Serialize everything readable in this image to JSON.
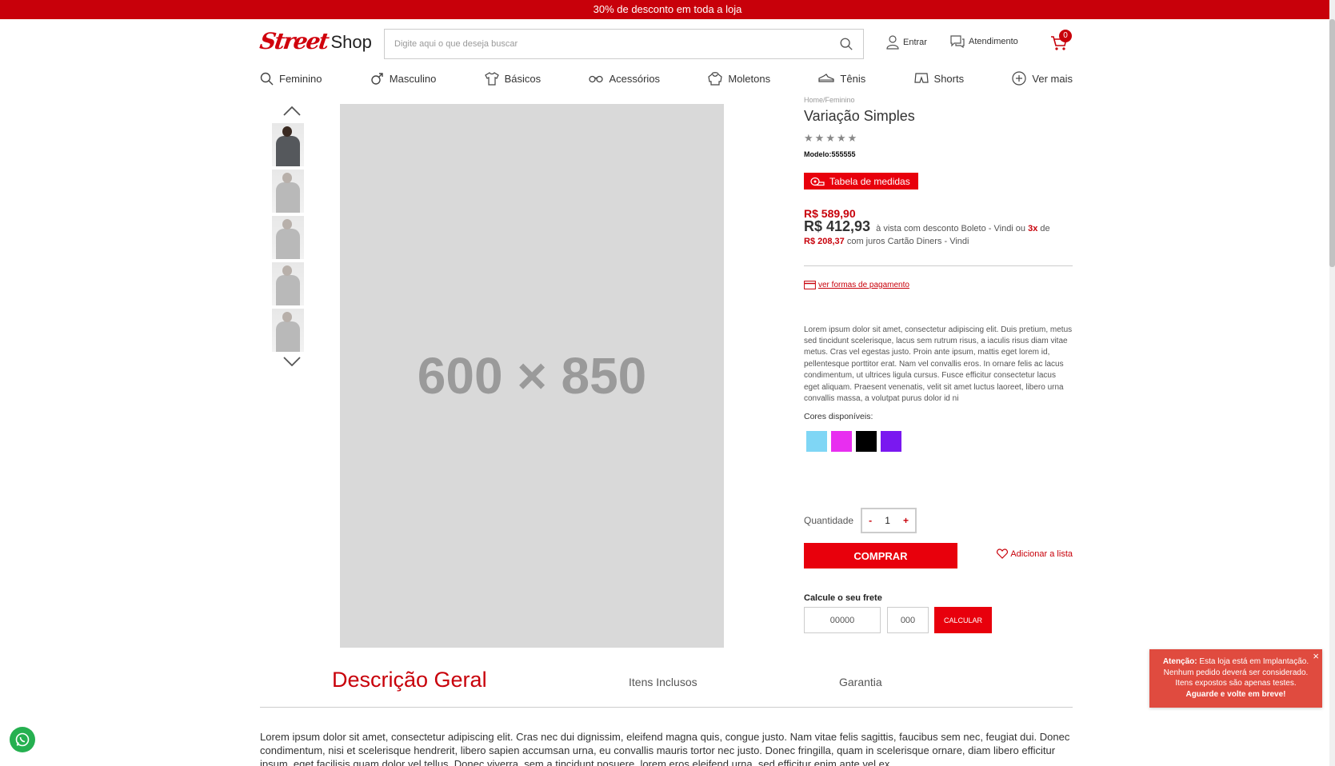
{
  "topbar": {
    "text": "30% de desconto em toda a loja"
  },
  "header": {
    "logo_mark": "Street",
    "logo_text": "Shop",
    "search_placeholder": "Digite aqui o que deseja buscar",
    "login_label": "Entrar",
    "support_label": "Atendimento",
    "cart_count": "0"
  },
  "nav": {
    "items": [
      {
        "label": "Feminino",
        "icon": "search-icon"
      },
      {
        "label": "Masculino",
        "icon": "male-symbol-icon"
      },
      {
        "label": "Básicos",
        "icon": "tshirt-icon"
      },
      {
        "label": "Acessórios",
        "icon": "glasses-icon"
      },
      {
        "label": "Moletons",
        "icon": "hoodie-icon"
      },
      {
        "label": "Tênis",
        "icon": "sneaker-icon"
      },
      {
        "label": "Shorts",
        "icon": "shorts-icon"
      },
      {
        "label": "Ver mais",
        "icon": "plus-circle-icon"
      }
    ]
  },
  "gallery": {
    "placeholder": "600 × 850",
    "thumb_count": 5,
    "active_thumb": 0
  },
  "product": {
    "breadcrumb_home": "Home",
    "breadcrumb_sep": "/",
    "breadcrumb_cat": "Feminino",
    "title": "Variação Simples",
    "rating": 0,
    "model_label": "Modelo:",
    "model_value": "555555",
    "size_table_label": "Tabela de medidas",
    "price_old": "R$ 589,90",
    "price_cash": "R$ 412,93",
    "price_cash_text": "à vista com desconto Boleto - Vindi ou",
    "installments": "3x",
    "installments_de": "de",
    "installment_value": "R$ 208,37",
    "installment_text": "com juros Cartão Diners - Vindi",
    "payment_link": "ver formas de pagamento",
    "description": "Lorem ipsum dolor sit amet, consectetur adipiscing elit. Duis pretium, metus sed tincidunt scelerisque, lacus sem rutrum risus, a iaculis risus diam vitae metus. Cras vel egestas justo. Proin ante ipsum, mattis eget lorem id, pellentesque porttitor erat. Nam vel convallis eros. In ornare felis ac lacus condimentum, ut ultrices ligula cursus. Fusce efficitur consectetur lacus eget aliquam. Praesent venenatis, velit sit amet luctus laoreet, libero urna convallis massa, a volutpat purus dolor id ni",
    "colors_label": "Cores disponíveis:",
    "colors": [
      "#7fd6f5",
      "#e82ef0",
      "#000000",
      "#7a18f0"
    ],
    "qty_label": "Quantidade",
    "qty_minus": "-",
    "qty_value": "1",
    "qty_plus": "+",
    "buy_label": "COMPRAR",
    "wishlist_label": "Adicionar a lista",
    "freight_label": "Calcule o seu frete",
    "cep1_placeholder": "00000",
    "cep2_placeholder": "000",
    "calc_label": "CALCULAR"
  },
  "tabs": {
    "active": "Descrição Geral",
    "second": "Itens Inclusos",
    "third": "Garantia"
  },
  "body_text": "Lorem ipsum dolor sit amet, consectetur adipiscing elit. Cras nec dui dignissim, eleifend magna quis, congue justo. Nam vitae felis sagittis, faucibus sem nec, feugiat dui. Donec condimentum, nisi et scelerisque hendrerit, libero sapien accumsan urna, eu convallis mauris tortor nec justo. Donec fringilla, quam in scelerisque ornare, diam libero efficitur ipsum, eget facilisis quam dolor vel tellus. Donec viverra, sem a tincidunt posuere, lorem eros eleifend urna, sed efficitur enim ante vel ex.",
  "toast": {
    "bold_label": "Atenção:",
    "text": "Esta loja está em Implantação. Nenhum pedido deverá ser considerado. Itens expostos são apenas testes.",
    "closing": "Aguarde e volte em breve!",
    "close": "×"
  },
  "colors": {
    "brand_red": "#c8000a",
    "button_red": "#e8000c",
    "toast_red": "#e04b3f",
    "whatsapp_green": "#25b050"
  }
}
